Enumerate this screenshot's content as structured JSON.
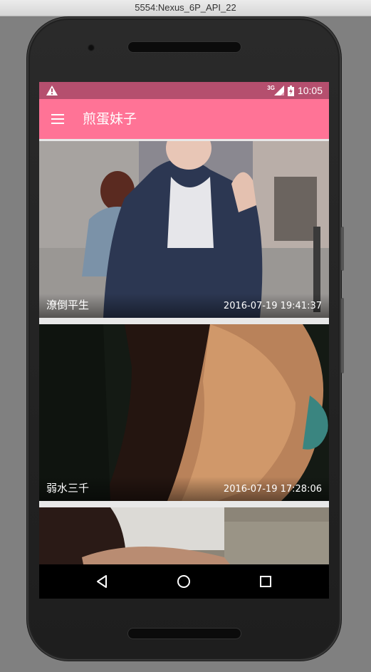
{
  "window": {
    "title": "5554:Nexus_6P_API_22"
  },
  "status_bar": {
    "network": "3G",
    "time": "10:05",
    "icons": [
      "warning-icon",
      "signal-icon",
      "battery-icon"
    ]
  },
  "app_bar": {
    "title": "煎蛋妹子",
    "menu_icon": "hamburger-menu-icon"
  },
  "feed": {
    "items": [
      {
        "name": "潦倒平生",
        "time": "2016-07-19 19:41:37"
      },
      {
        "name": "弱水三千",
        "time": "2016-07-19 17:28:06"
      }
    ]
  },
  "nav_bar": {
    "icons": [
      "back-icon",
      "home-icon",
      "recents-icon"
    ]
  },
  "colors": {
    "status_bar": "#b54f6e",
    "app_bar": "#ff7396",
    "emulator_bg": "#808080"
  }
}
